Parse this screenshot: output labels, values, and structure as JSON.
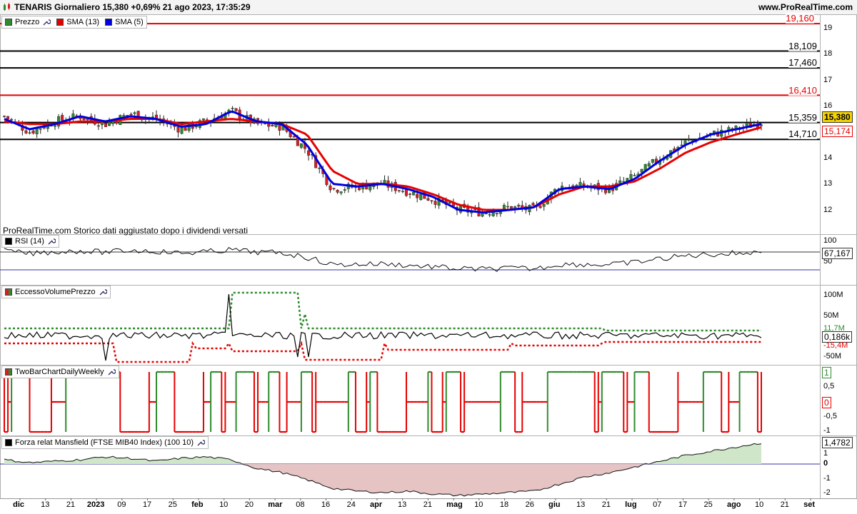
{
  "header": {
    "title": "TENARIS Giornaliero 15,380 +0,69% 21 ago 2023, 17:35:29",
    "brand": "www.ProRealTime.com"
  },
  "price_panel": {
    "legend": [
      {
        "label": "Prezzo",
        "icon": "candles-icon",
        "color": "#2e7d32"
      },
      {
        "label": "SMA (13)",
        "color": "#e60000"
      },
      {
        "label": "SMA (5)",
        "color": "#0000dd"
      }
    ],
    "note": "ProRealTime.com Storico dati aggiustato dopo i dividendi versati",
    "y_ticks": [
      "19",
      "18",
      "17",
      "16",
      "15",
      "14",
      "13",
      "12"
    ],
    "levels": [
      {
        "value": "19,160",
        "color": "#e60000"
      },
      {
        "value": "18,109",
        "color": "#000000"
      },
      {
        "value": "17,460",
        "color": "#000000"
      },
      {
        "value": "16,410",
        "color": "#e60000"
      },
      {
        "value": "15,359",
        "color": "#000000"
      },
      {
        "value": "14,710",
        "color": "#000000"
      }
    ],
    "last_price": "15,380",
    "sma13_value": "15,174"
  },
  "rsi_panel": {
    "legend": "RSI (14)",
    "y_ticks": [
      "100",
      "50"
    ],
    "value": "67,167"
  },
  "volume_panel": {
    "legend": "EccessoVolumePrezzo",
    "y_ticks": [
      "100M",
      "50M"
    ],
    "upper_value": "11,7M",
    "value": "0,186k",
    "lower_value": "-15,4M",
    "neg_tick": "-50M"
  },
  "twobar_panel": {
    "legend": "TwoBarChartDailyWeekly",
    "y_ticks": [
      "1",
      "0,5",
      "0",
      "-0,5",
      "-1"
    ]
  },
  "mansfield_panel": {
    "legend": "Forza relat Mansfield (FTSE MIB40 Index) (100 10)",
    "y_ticks": [
      "1,4782",
      "1",
      "0",
      "-1",
      "-2"
    ]
  },
  "x_axis": [
    "dic",
    "13",
    "21",
    "2023",
    "09",
    "17",
    "25",
    "feb",
    "10",
    "20",
    "mar",
    "08",
    "16",
    "24",
    "apr",
    "13",
    "21",
    "mag",
    "10",
    "18",
    "26",
    "giu",
    "13",
    "21",
    "lug",
    "07",
    "17",
    "25",
    "ago",
    "10",
    "21",
    "set"
  ],
  "colors": {
    "up": "#2e8b2e",
    "down": "#d62020",
    "sma13": "#e60000",
    "sma5": "#0000dd",
    "level_red": "#e60000"
  },
  "chart_data": {
    "type": "line",
    "title": "TENARIS Giornaliero",
    "x": [
      "dic",
      "13",
      "21",
      "2023",
      "09",
      "17",
      "25",
      "feb",
      "10",
      "20",
      "mar",
      "08",
      "16",
      "24",
      "apr",
      "13",
      "21",
      "mag",
      "10",
      "18",
      "26",
      "giu",
      "13",
      "21",
      "lug",
      "07",
      "17",
      "25",
      "ago",
      "10",
      "21"
    ],
    "series": [
      {
        "name": "Prezzo",
        "values": [
          15.6,
          15.0,
          15.4,
          15.6,
          15.3,
          15.7,
          15.5,
          15.1,
          15.4,
          15.8,
          15.3,
          15.2,
          14.3,
          12.8,
          12.9,
          13.0,
          12.7,
          12.4,
          12.0,
          11.9,
          12.1,
          12.0,
          12.9,
          12.9,
          12.8,
          13.3,
          14.0,
          14.6,
          14.9,
          15.1,
          15.38
        ]
      },
      {
        "name": "SMA (13)",
        "values": [
          15.4,
          15.3,
          15.3,
          15.4,
          15.4,
          15.5,
          15.5,
          15.3,
          15.4,
          15.5,
          15.4,
          15.3,
          14.9,
          13.5,
          13.0,
          13.0,
          12.9,
          12.6,
          12.2,
          12.0,
          12.0,
          12.1,
          12.6,
          12.9,
          12.9,
          13.1,
          13.6,
          14.2,
          14.6,
          14.9,
          15.174
        ]
      },
      {
        "name": "SMA (5)",
        "values": [
          15.5,
          15.1,
          15.3,
          15.6,
          15.4,
          15.6,
          15.5,
          15.2,
          15.3,
          15.8,
          15.4,
          15.3,
          14.5,
          13.0,
          12.9,
          13.0,
          12.8,
          12.5,
          12.0,
          11.9,
          12.0,
          12.1,
          12.8,
          12.9,
          12.8,
          13.2,
          13.9,
          14.5,
          14.9,
          15.1,
          15.3
        ]
      }
    ],
    "ylim": [
      11.4,
      19.4
    ],
    "grid": false
  }
}
